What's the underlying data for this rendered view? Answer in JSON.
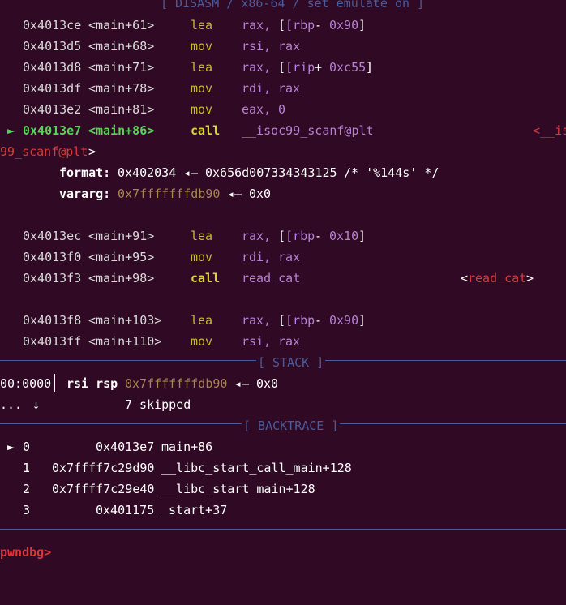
{
  "headers": {
    "disasm": "[ DISASM / x86-64 / set emulate on ]",
    "stack": "[ STACK ]",
    "backtrace": "[ BACKTRACE ]"
  },
  "disasm": [
    {
      "addr": "0x4013ce",
      "sym": "<main+61>",
      "op": "lea",
      "a1": "rax,",
      "a2": "[rbp",
      "a3": "-",
      "a4": "0x90",
      "a5": "]"
    },
    {
      "addr": "0x4013d5",
      "sym": "<main+68>",
      "op": "mov",
      "a1": "rsi,",
      "a2": "rax"
    },
    {
      "addr": "0x4013d8",
      "sym": "<main+71>",
      "op": "lea",
      "a1": "rax,",
      "a2": "[rip",
      "a3": "+",
      "a4": "0xc55",
      "a5": "]"
    },
    {
      "addr": "0x4013df",
      "sym": "<main+78>",
      "op": "mov",
      "a1": "rdi,",
      "a2": "rax"
    },
    {
      "addr": "0x4013e2",
      "sym": "<main+81>",
      "op": "mov",
      "a1": "eax,",
      "a4": "0"
    },
    {
      "marker": "►",
      "addr": "0x4013e7",
      "sym": "<main+86>",
      "op": "call",
      "target": "__isoc99_scanf@plt",
      "target_right": "<__is",
      "wrap": "99_scanf@plt",
      "wrap_close": ">"
    },
    {
      "addr": "0x4013ec",
      "sym": "<main+91>",
      "op": "lea",
      "a1": "rax,",
      "a2": "[rbp",
      "a3": "-",
      "a4": "0x10",
      "a5": "]"
    },
    {
      "addr": "0x4013f0",
      "sym": "<main+95>",
      "op": "mov",
      "a1": "rdi,",
      "a2": "rax"
    },
    {
      "addr": "0x4013f3",
      "sym": "<main+98>",
      "op": "call",
      "target": "read_cat",
      "tr_open": "<",
      "tr_name": "read_cat",
      "tr_close": ">"
    },
    {
      "addr": "0x4013f8",
      "sym": "<main+103>",
      "op": "lea",
      "a1": "rax,",
      "a2": "[rbp",
      "a3": "-",
      "a4": "0x90",
      "a5": "]"
    },
    {
      "addr": "0x4013ff",
      "sym": "<main+110>",
      "op": "mov",
      "a1": "rsi,",
      "a2": "rax"
    }
  ],
  "args": {
    "format_label": "format:",
    "format_addr": "0x402034",
    "arrow": "◂—",
    "format_val": "0x656d007334343125",
    "format_comment": "/* '%144s' */",
    "vararg_label": "vararg:",
    "vararg_addr": "0x7fffffffdb90",
    "vararg_val": "0x0"
  },
  "stack": {
    "offset": "00:0000",
    "regs": "rsi rsp",
    "addr": "0x7fffffffdb90",
    "arrow": "◂—",
    "val": "0x0",
    "dots": "...",
    "down": "↓",
    "skipped": "7 skipped"
  },
  "backtrace": [
    {
      "marker": "►",
      "idx": "0",
      "addr": "0x4013e7",
      "sym": "main+86"
    },
    {
      "idx": "1",
      "addr": "0x7ffff7c29d90",
      "sym": "__libc_start_call_main+128"
    },
    {
      "idx": "2",
      "addr": "0x7ffff7c29e40",
      "sym": "__libc_start_main+128"
    },
    {
      "idx": "3",
      "addr": "0x401175",
      "sym": "_start+37"
    }
  ],
  "prompt": "pwndbg>",
  "colors": {
    "background": "#300a24",
    "opcode": "#c4bc2c",
    "register": "#b581d4",
    "symbol": "#d83a3a",
    "current": "#4cc25a",
    "stack_addr": "#a88450",
    "separator": "#4b5a9a"
  }
}
